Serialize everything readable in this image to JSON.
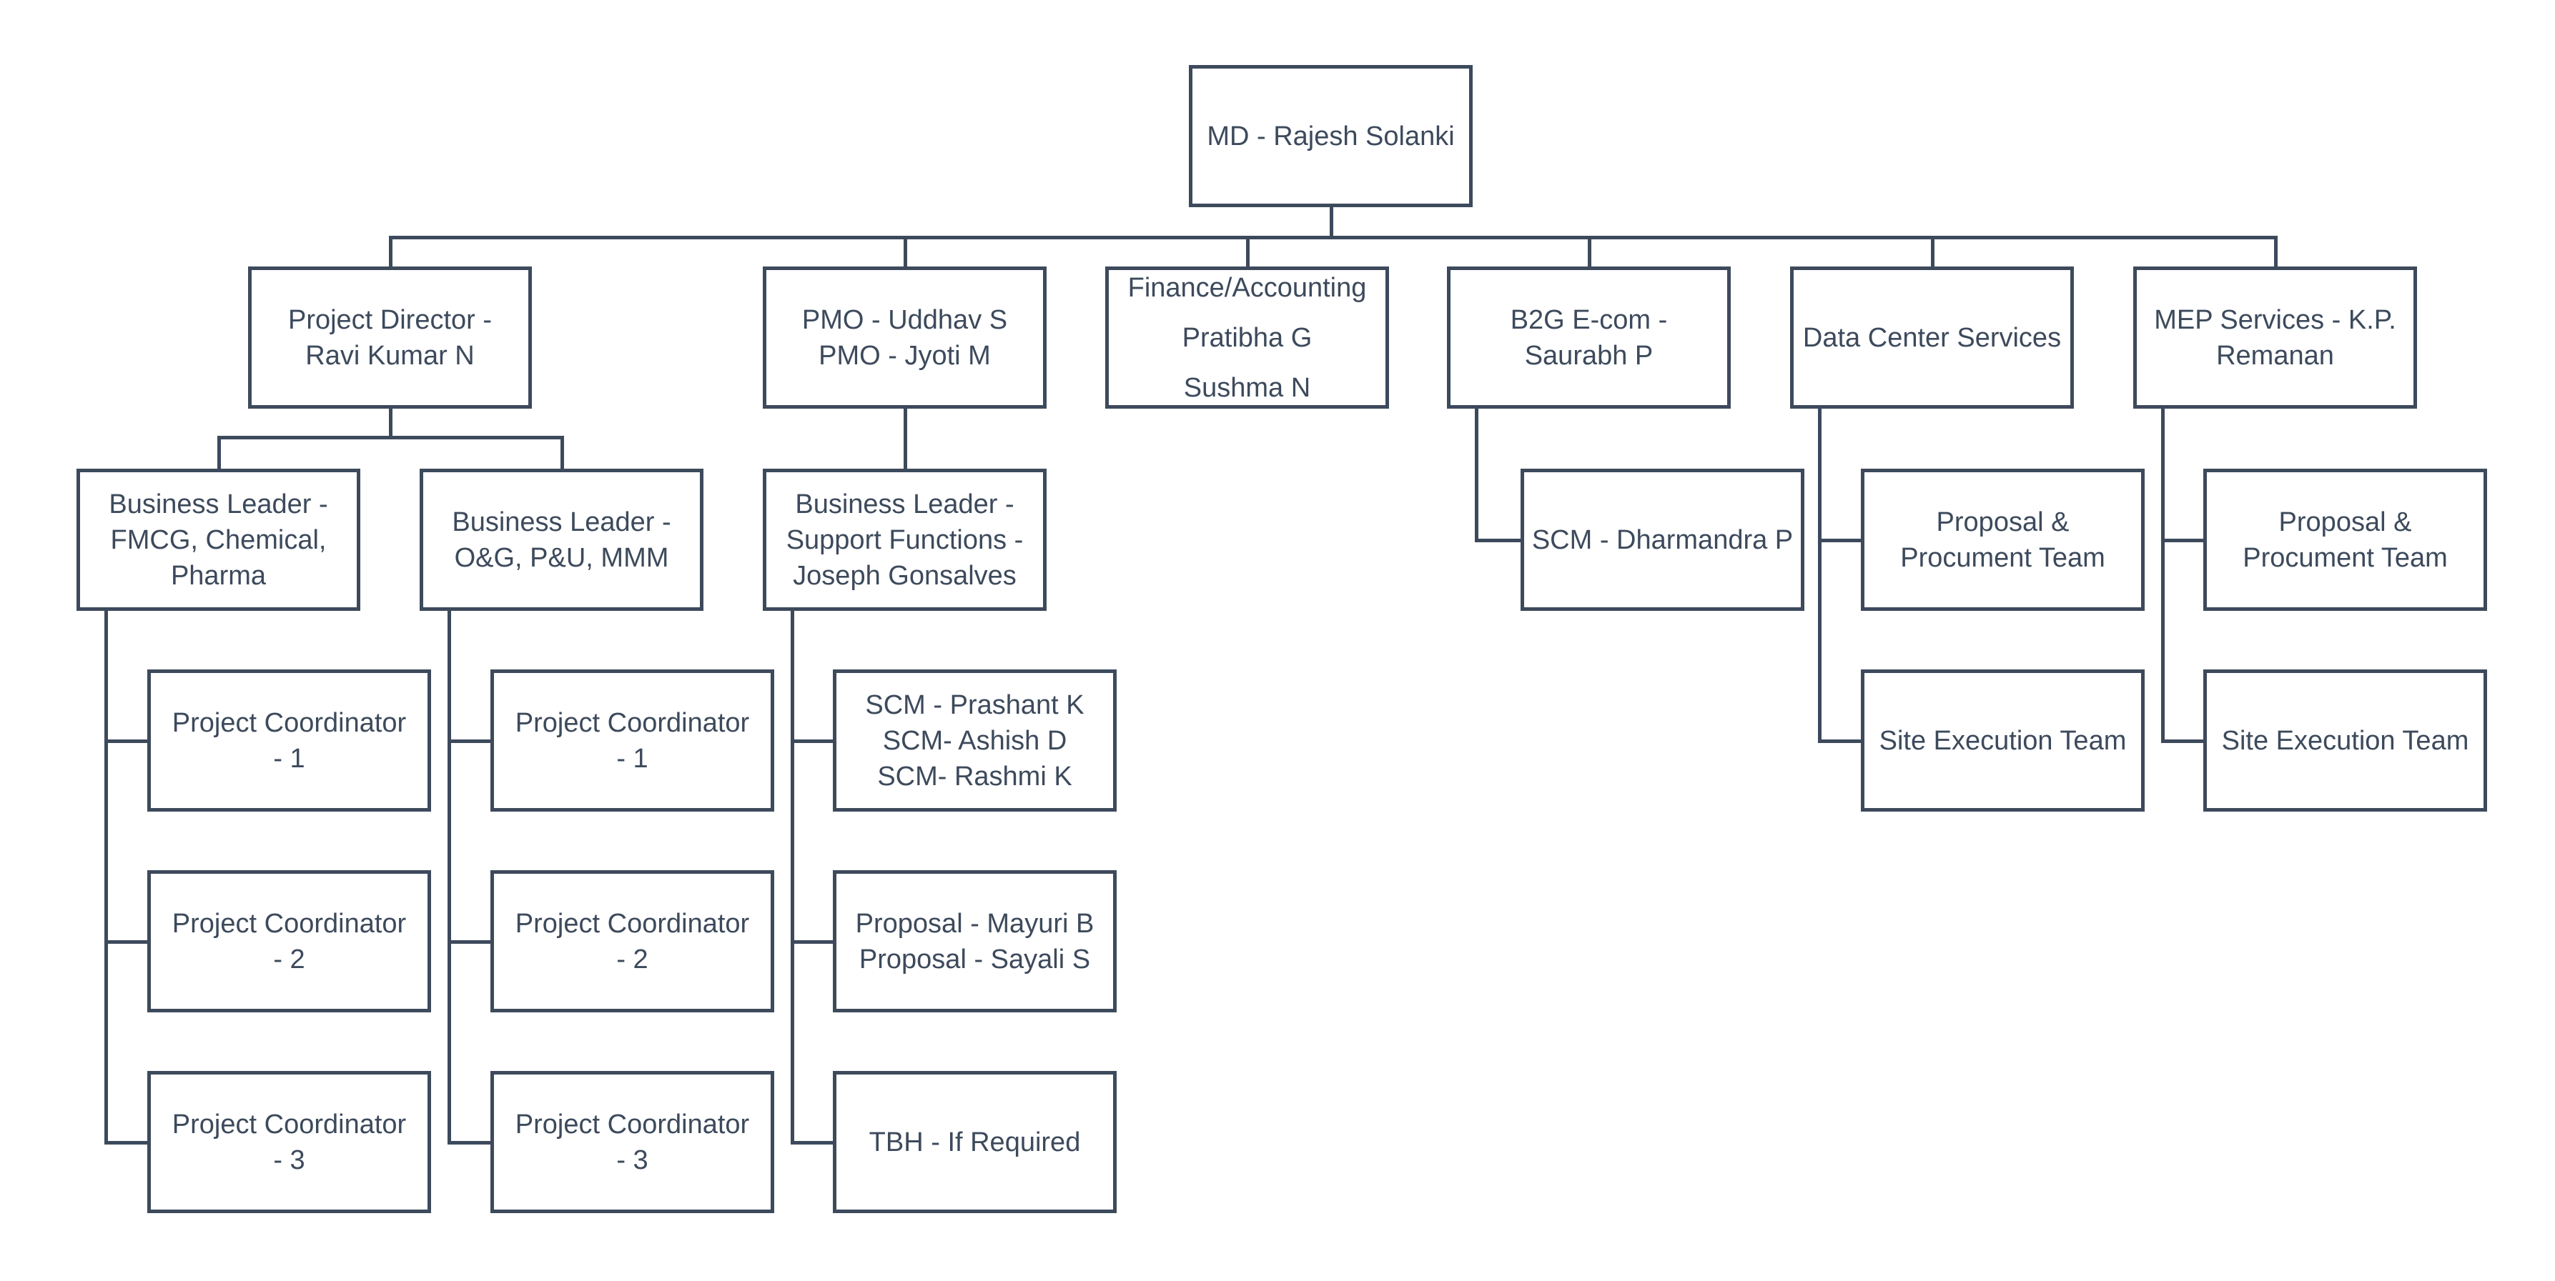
{
  "diagram": {
    "type": "org-chart",
    "colors": {
      "stroke": "#3d4a5c",
      "text": "#3d4a5c",
      "background": "#ffffff"
    },
    "root": {
      "id": "md",
      "lines": [
        "MD - Rajesh Solanki"
      ]
    },
    "level1": [
      {
        "id": "pd",
        "lines": [
          "Project Director -",
          "Ravi Kumar N"
        ]
      },
      {
        "id": "pmo",
        "lines": [
          "PMO - Uddhav S",
          "PMO - Jyoti M"
        ]
      },
      {
        "id": "fin",
        "lines": [
          "Finance/Accounting",
          "Pratibha G",
          "Sushma N"
        ]
      },
      {
        "id": "b2g",
        "lines": [
          "B2G E-com -",
          "Saurabh P"
        ]
      },
      {
        "id": "dcs",
        "lines": [
          "Data Center Services"
        ]
      },
      {
        "id": "mep",
        "lines": [
          "MEP Services - K.P.",
          "Remanan"
        ]
      }
    ],
    "level2": [
      {
        "id": "bl_fmcg",
        "parent": "pd",
        "lines": [
          "Business Leader -",
          "FMCG, Chemical,",
          "Pharma"
        ]
      },
      {
        "id": "bl_og",
        "parent": "pd",
        "lines": [
          "Business Leader -",
          "O&G, P&U, MMM"
        ]
      },
      {
        "id": "bl_support",
        "parent": "pmo",
        "lines": [
          "Business Leader -",
          "Support Functions -",
          "Joseph Gonsalves"
        ]
      },
      {
        "id": "scm_d",
        "parent": "b2g",
        "lines": [
          "SCM - Dharmandra P"
        ]
      },
      {
        "id": "dcs_prop",
        "parent": "dcs",
        "lines": [
          "Proposal &",
          "Procument Team"
        ]
      },
      {
        "id": "mep_prop",
        "parent": "mep",
        "lines": [
          "Proposal &",
          "Procument Team"
        ]
      }
    ],
    "level3": [
      {
        "id": "pc1_a",
        "parent": "bl_fmcg",
        "lines": [
          "Project Coordinator",
          "- 1"
        ]
      },
      {
        "id": "pc2_a",
        "parent": "bl_fmcg",
        "lines": [
          "Project Coordinator",
          "- 2"
        ]
      },
      {
        "id": "pc3_a",
        "parent": "bl_fmcg",
        "lines": [
          "Project Coordinator",
          "- 3"
        ]
      },
      {
        "id": "pc1_b",
        "parent": "bl_og",
        "lines": [
          "Project Coordinator",
          "- 1"
        ]
      },
      {
        "id": "pc2_b",
        "parent": "bl_og",
        "lines": [
          "Project Coordinator",
          "- 2"
        ]
      },
      {
        "id": "pc3_b",
        "parent": "bl_og",
        "lines": [
          "Project Coordinator",
          "- 3"
        ]
      },
      {
        "id": "scm_list",
        "parent": "bl_support",
        "lines": [
          "SCM - Prashant K",
          "SCM- Ashish D",
          "SCM- Rashmi K"
        ]
      },
      {
        "id": "proposal_list",
        "parent": "bl_support",
        "lines": [
          "Proposal - Mayuri B",
          "Proposal - Sayali S"
        ]
      },
      {
        "id": "tbh",
        "parent": "bl_support",
        "lines": [
          "TBH - If Required"
        ]
      },
      {
        "id": "dcs_site",
        "parent": "dcs",
        "lines": [
          "Site Execution Team"
        ]
      },
      {
        "id": "mep_site",
        "parent": "mep",
        "lines": [
          "Site Execution Team"
        ]
      }
    ]
  }
}
